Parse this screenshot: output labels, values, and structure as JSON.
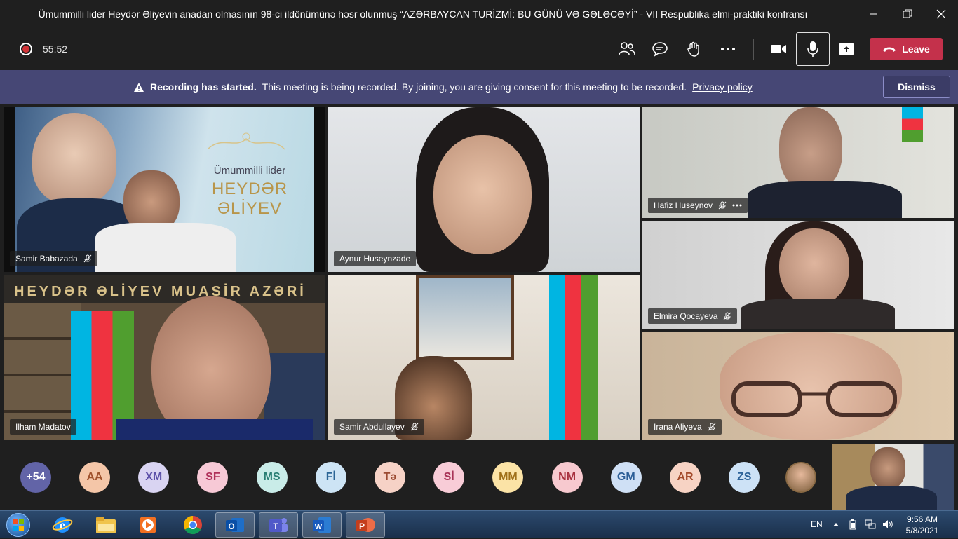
{
  "window": {
    "title": "Ümummilli lider Heydər Əliyevin anadan olmasının 98-ci ildönümünə həsr olunmuş “AZƏRBAYCAN TURİZMİ: BU GÜNÜ VƏ GƏLƏCƏYİ” - VII Respublika elmi-praktiki konfransı"
  },
  "toolbar": {
    "timer": "55:52",
    "leave_label": "Leave",
    "icons": [
      "participants-icon",
      "chat-icon",
      "raise-hand-icon",
      "more-actions-icon",
      "camera-icon",
      "microphone-icon",
      "share-screen-icon"
    ]
  },
  "banner": {
    "bold_text": "Recording has started.",
    "text": "This meeting is being recorded. By joining, you are giving consent for this meeting to be recorded.",
    "link": "Privacy policy",
    "dismiss_label": "Dismiss"
  },
  "tiles": {
    "samir_b": {
      "name": "Samir Babazada",
      "slide_line1": "Ümummilli lider",
      "slide_line2": "HEYDƏR",
      "slide_line3": "ƏLİYEV"
    },
    "aynur": {
      "name": "Aynur Huseynzade"
    },
    "hafiz": {
      "name": "Hafiz Huseynov"
    },
    "ilham": {
      "name": "Ilham Madatov",
      "wall_text": "HEYDƏR ƏLİYEV MUASİR AZƏRİ"
    },
    "samir_a": {
      "name": "Samir Abdullayev"
    },
    "elmira": {
      "name": "Elmira Qocayeva"
    },
    "irana": {
      "name": "Irana Aliyeva"
    }
  },
  "roster": {
    "overflow": "+54",
    "avatars": [
      {
        "initials": "AA",
        "bg": "#f4c6a8",
        "fg": "#a0522d"
      },
      {
        "initials": "XM",
        "bg": "#d9d4f2",
        "fg": "#5b4fa8"
      },
      {
        "initials": "SF",
        "bg": "#f7c9d6",
        "fg": "#b0305a"
      },
      {
        "initials": "MS",
        "bg": "#c9ece8",
        "fg": "#2a7f74"
      },
      {
        "initials": "Fİ",
        "bg": "#cde4f5",
        "fg": "#2b6596"
      },
      {
        "initials": "Tə",
        "bg": "#f6d2c6",
        "fg": "#9c4c33"
      },
      {
        "initials": "Sİ",
        "bg": "#f8ccd7",
        "fg": "#a83357"
      },
      {
        "initials": "MM",
        "bg": "#fbe3a6",
        "fg": "#a0701a"
      },
      {
        "initials": "NM",
        "bg": "#f7c9cf",
        "fg": "#a8313f"
      },
      {
        "initials": "GM",
        "bg": "#cfe0f5",
        "fg": "#2d5f97"
      },
      {
        "initials": "AR",
        "bg": "#f7d3c4",
        "fg": "#a44b2c"
      },
      {
        "initials": "ZS",
        "bg": "#cde2f6",
        "fg": "#2d6399"
      }
    ]
  },
  "taskbar": {
    "language": "EN",
    "time": "9:56 AM",
    "date": "5/8/2021",
    "apps": [
      "internet-explorer-icon",
      "file-explorer-icon",
      "media-player-icon",
      "chrome-icon",
      "outlook-icon",
      "teams-icon",
      "word-icon",
      "powerpoint-icon"
    ]
  },
  "colors": {
    "leave": "#c4314b",
    "banner": "#464775",
    "overflow_avatar": "#6264a7"
  }
}
